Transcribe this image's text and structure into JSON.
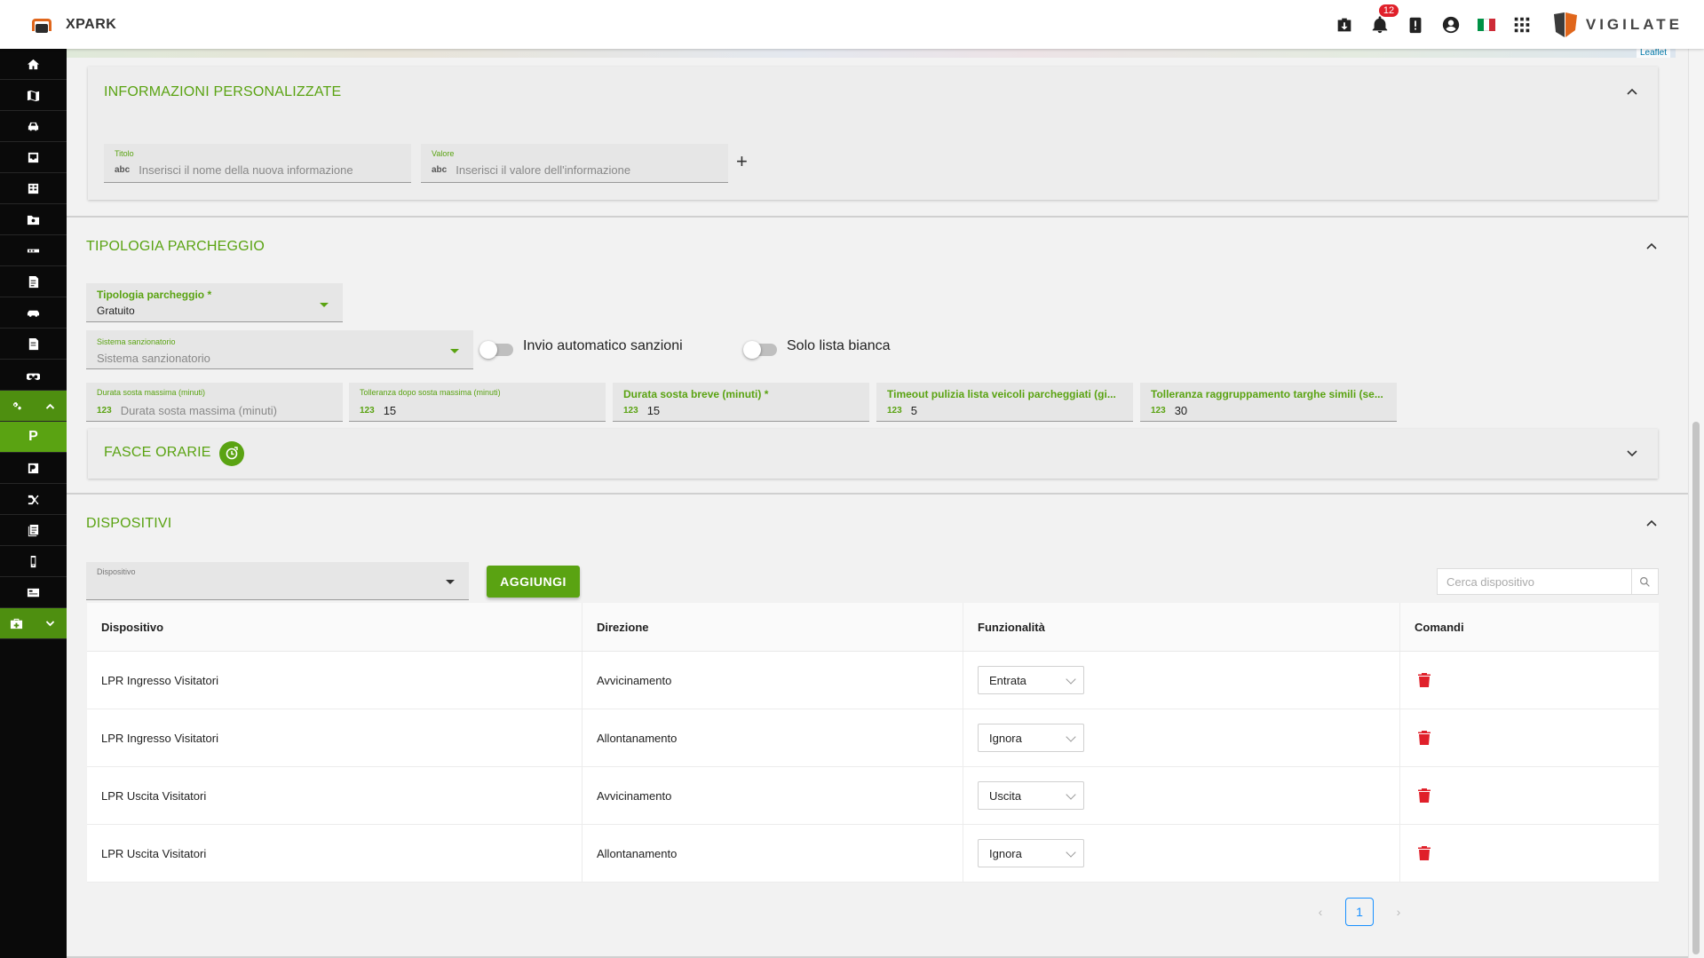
{
  "header": {
    "app_title": "XPARK",
    "notification_count": "12",
    "brand": "VIGILATE",
    "map_attribution": "Leaflet",
    "icons": [
      "download-box-icon",
      "bell-icon",
      "alert-clipboard-icon",
      "account-circle-icon",
      "italy-flag-icon",
      "apps-grid-icon"
    ],
    "flag_colors": [
      "#009246",
      "#ffffff",
      "#ce2b37"
    ]
  },
  "sidebar": {
    "items": [
      "home-icon",
      "map-icon",
      "car-icon",
      "inbox-icon",
      "table-icon",
      "folder-icon",
      "camera-icon",
      "report-icon",
      "vehicle-icon",
      "document-icon",
      "binoculars-icon"
    ],
    "settings_group": {
      "icon": "gears-icon",
      "expanded": true
    },
    "active_label": "P",
    "sub_items": [
      "parking-map-icon",
      "route-icon",
      "list-icon",
      "device-icon",
      "card-icon"
    ],
    "bottom_group": {
      "icon": "toolbox-icon",
      "expanded": false
    }
  },
  "custom_info": {
    "title": "INFORMAZIONI PERSONALIZZATE",
    "title_field": {
      "label": "Titolo",
      "prefix": "abc",
      "placeholder": "Inserisci il nome della nuova informazione"
    },
    "value_field": {
      "label": "Valore",
      "prefix": "abc",
      "placeholder": "Inserisci il valore dell'informazione"
    },
    "add_symbol": "+"
  },
  "parking_type": {
    "title": "TIPOLOGIA PARCHEGGIO",
    "type_field": {
      "label": "Tipologia parcheggio *",
      "value": "Gratuito"
    },
    "sanction_field": {
      "label": "Sistema sanzionatorio",
      "placeholder": "Sistema sanzionatorio"
    },
    "toggle_auto_sanctions": {
      "label": "Invio automatico sanzioni",
      "on": false
    },
    "toggle_whitelist": {
      "label": "Solo lista bianca",
      "on": false
    },
    "numeric_fields": [
      {
        "label": "Durata sosta massima (minuti)",
        "prefix": "123",
        "value": "",
        "placeholder": "Durata sosta massima (minuti)",
        "bold": false
      },
      {
        "label": "Tolleranza dopo sosta massima (minuti)",
        "prefix": "123",
        "value": "15",
        "bold": false
      },
      {
        "label": "Durata sosta breve (minuti) *",
        "prefix": "123",
        "value": "15",
        "bold": true
      },
      {
        "label": "Timeout pulizia lista veicoli parcheggiati (gi...",
        "prefix": "123",
        "value": "5",
        "bold": true
      },
      {
        "label": "Tolleranza raggruppamento targhe simili (se...",
        "prefix": "123",
        "value": "30",
        "bold": true
      }
    ]
  },
  "time_slots": {
    "title": "FASCE ORARIE"
  },
  "devices": {
    "title": "DISPOSITIVI",
    "device_select": {
      "label": "Dispositivo",
      "value": ""
    },
    "add_button": "AGGIUNGI",
    "search_placeholder": "Cerca dispositivo",
    "columns": [
      "Dispositivo",
      "Direzione",
      "Funzionalità",
      "Comandi"
    ],
    "rows": [
      {
        "device": "LPR Ingresso Visitatori",
        "direction": "Avvicinamento",
        "function": "Entrata"
      },
      {
        "device": "LPR Ingresso Visitatori",
        "direction": "Allontanamento",
        "function": "Ignora"
      },
      {
        "device": "LPR Uscita Visitatori",
        "direction": "Avvicinamento",
        "function": "Uscita"
      },
      {
        "device": "LPR Uscita Visitatori",
        "direction": "Allontanamento",
        "function": "Ignora"
      }
    ],
    "pagination": {
      "current": "1",
      "prev": "‹",
      "next": "›"
    }
  },
  "colors": {
    "accent": "#5aa312",
    "delete": "#e0202a",
    "sidebar": "#0a0a0a"
  }
}
